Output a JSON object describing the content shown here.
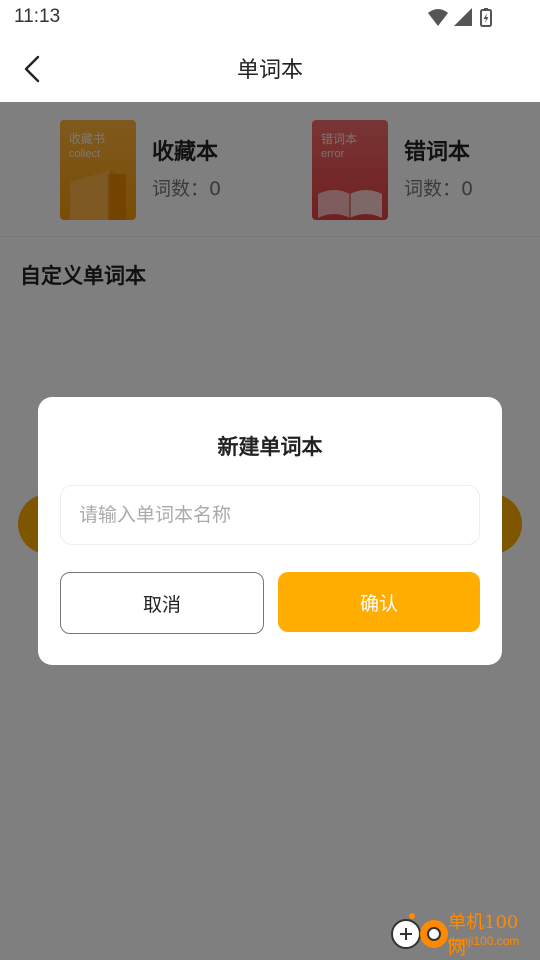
{
  "status_bar": {
    "time": "11:13",
    "icons": [
      "wifi-icon",
      "signal-icon",
      "battery-icon"
    ]
  },
  "header": {
    "title": "单词本",
    "back_icon": "chevron-left-icon"
  },
  "books": [
    {
      "cover_title": "收藏书",
      "cover_subtitle": "collect",
      "name": "收藏本",
      "count_label": "词数：",
      "count": "0",
      "cover_color": "#f7a21d"
    },
    {
      "cover_title": "错词本",
      "cover_subtitle": "error",
      "name": "错词本",
      "count_label": "词数：",
      "count": "0",
      "cover_color": "#e64a4a"
    }
  ],
  "section": {
    "custom_title": "自定义单词本"
  },
  "dialog": {
    "title": "新建单词本",
    "input_placeholder": "请输入单词本名称",
    "input_value": "",
    "cancel_label": "取消",
    "confirm_label": "确认"
  },
  "watermark": {
    "line1": "单机100网",
    "line2": "danji100.com"
  },
  "colors": {
    "accent": "#ffad00",
    "overlay": "rgba(0,0,0,0.5)"
  }
}
